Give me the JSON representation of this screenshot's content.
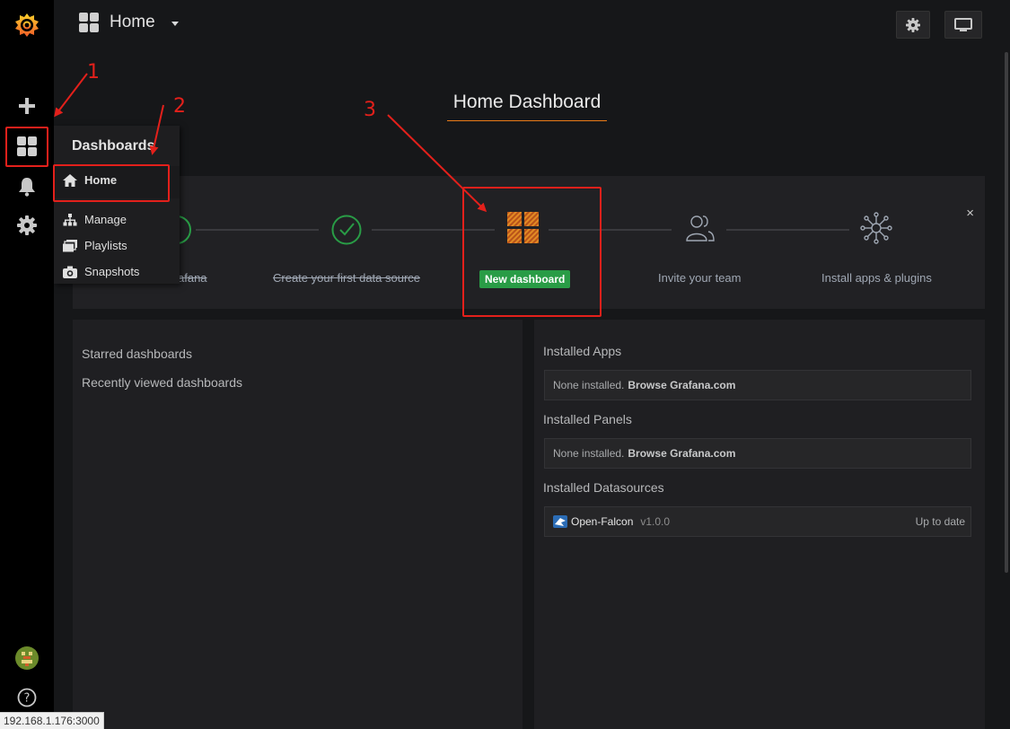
{
  "topbar": {
    "title": "Home",
    "settings_icon": "gear-icon",
    "tv_icon": "monitor-icon"
  },
  "page": {
    "heading": "Home Dashboard"
  },
  "sidebar": {
    "items": [
      {
        "icon": "grafana-logo"
      },
      {
        "icon": "plus-icon"
      },
      {
        "icon": "dashboards-grid-icon"
      },
      {
        "icon": "bell-icon"
      },
      {
        "icon": "gear-icon"
      },
      {
        "icon": "avatar"
      },
      {
        "icon": "help-icon"
      }
    ]
  },
  "flyout": {
    "title": "Dashboards",
    "items": [
      {
        "label": "Home",
        "icon": "home-icon"
      },
      {
        "label": "Manage",
        "icon": "sitemap-icon"
      },
      {
        "label": "Playlists",
        "icon": "playlist-icon"
      },
      {
        "label": "Snapshots",
        "icon": "camera-icon"
      }
    ]
  },
  "getting_started": {
    "steps": [
      {
        "label": "Install Grafana",
        "visible_label": "afana",
        "done": true
      },
      {
        "label": "Create your first data source",
        "done": true
      },
      {
        "label": "New dashboard",
        "current": true
      },
      {
        "label": "Invite your team"
      },
      {
        "label": "Install apps & plugins"
      }
    ],
    "close_label": "×"
  },
  "left_panel": {
    "starred": "Starred dashboards",
    "recent": "Recently viewed dashboards"
  },
  "right_panel": {
    "apps_heading": "Installed Apps",
    "apps_none": "None installed.",
    "apps_browse": "Browse Grafana.com",
    "panels_heading": "Installed Panels",
    "panels_none": "None installed.",
    "panels_browse": "Browse Grafana.com",
    "ds_heading": "Installed Datasources",
    "datasource": {
      "name": "Open-Falcon",
      "version": "v1.0.0",
      "status": "Up to date"
    }
  },
  "annotations": {
    "n1": "1",
    "n2": "2",
    "n3": "3"
  },
  "status_bar": {
    "url": "192.168.1.176:3000"
  },
  "colors": {
    "accent": "#eb7b18",
    "annotation": "#e3201b",
    "success": "#299c46",
    "check": "#299c46"
  }
}
